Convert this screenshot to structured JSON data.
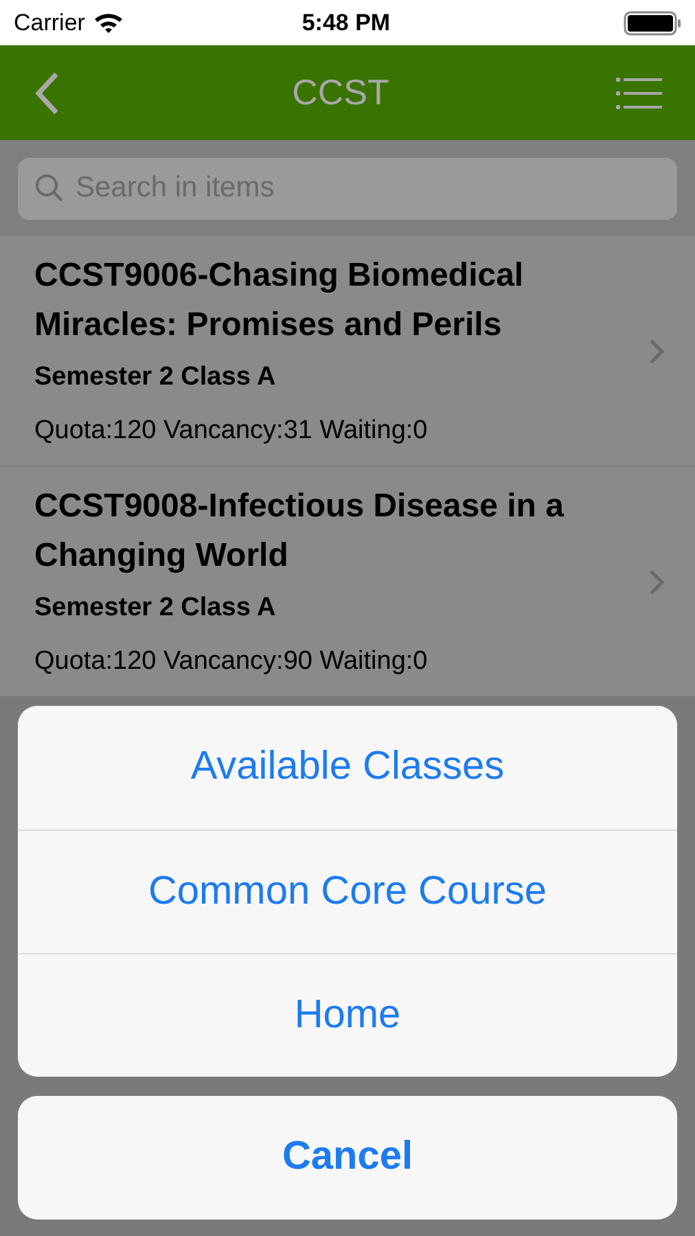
{
  "status_bar": {
    "carrier": "Carrier",
    "time": "5:48 PM"
  },
  "nav_bar": {
    "title": "CCST"
  },
  "search": {
    "placeholder": "Search in items"
  },
  "items": [
    {
      "title": "CCST9006-Chasing Biomedical Miracles: Promises and Perils",
      "class": "Semester 2 Class A",
      "info": "Quota:120 Vancancy:31 Waiting:0"
    },
    {
      "title": "CCST9008-Infectious Disease in a Changing World",
      "class": "Semester 2 Class A",
      "info": "Quota:120 Vancancy:90 Waiting:0"
    }
  ],
  "action_sheet": {
    "actions": [
      "Available Classes",
      "Common Core Course",
      "Home"
    ],
    "cancel": "Cancel"
  }
}
